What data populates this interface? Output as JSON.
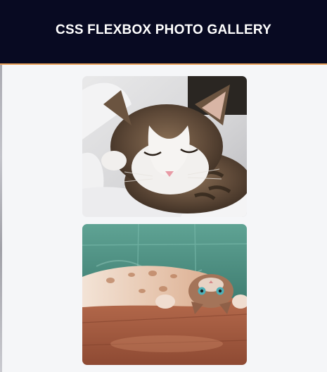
{
  "header": {
    "title": "CSS FLEXBOX PHOTO GALLERY"
  },
  "gallery": {
    "photos": [
      {
        "subject": "sleeping tabby-and-white cat on white bedding"
      },
      {
        "subject": "cat lying upside down on wooden floor against green tiled wall"
      }
    ]
  },
  "colors": {
    "header_bg": "#080a22",
    "header_border": "#e9a15a",
    "page_bg": "#f5f6f8",
    "title_text": "#ffffff"
  }
}
